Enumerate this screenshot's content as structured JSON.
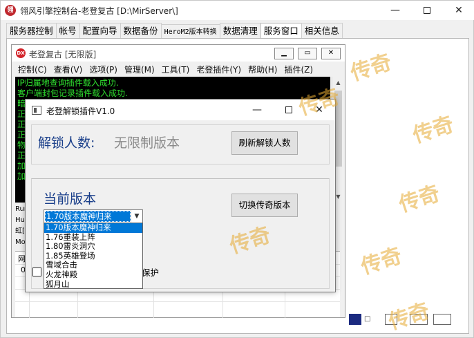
{
  "main_window": {
    "title": "翎风引擎控制台-老登复古 [D:\\MirServer\\]",
    "controls": {
      "minimize": "—",
      "close": "✕"
    },
    "tabs": [
      {
        "label": "服务器控制"
      },
      {
        "label": "帐号"
      },
      {
        "label": "配置向导"
      },
      {
        "label": "数据备份"
      },
      {
        "label": "HeroM2版本转换"
      },
      {
        "label": "数据清理"
      },
      {
        "label": "服务窗口"
      },
      {
        "label": "相关信息"
      }
    ],
    "active_tab": "服务窗口"
  },
  "inner_window": {
    "icon_text": "DX",
    "title": "老登复古 [无限版]",
    "menu": [
      {
        "label": "控制(C)"
      },
      {
        "label": "查看(V)"
      },
      {
        "label": "选项(P)"
      },
      {
        "label": "管理(M)"
      },
      {
        "label": "工具(T)"
      },
      {
        "label": "老登插件(Y)"
      },
      {
        "label": "帮助(H)"
      },
      {
        "label": "插件(Z)"
      }
    ],
    "console_lines": [
      "IP归属地查询插件载入成功.",
      "客户端封包记录插件载入成功.",
      "暗",
      "正",
      "正",
      "正",
      "物",
      "正",
      "加",
      "加"
    ],
    "info_lines": [
      "Run",
      "Hum",
      "虹[",
      "Mor"
    ],
    "grid_cells": [
      "网",
      "0"
    ]
  },
  "dialog": {
    "title": "老登解锁插件V1.0",
    "controls": {
      "minimize": "—",
      "close": "✕"
    },
    "unlock_label": "解锁人数:",
    "unlock_value": "无限制版本",
    "refresh_button": "刷新解锁人数",
    "version_label": "当前版本",
    "switch_button": "切换传奇版本",
    "version_select": {
      "selected": "1.70版本魔神归来",
      "options": [
        "1.70版本魔神归来",
        "1.76重装上阵",
        "1.80雷炎洞穴",
        "1.85英雄登场",
        "雪域合击",
        "火龙神殿",
        "狐月山"
      ]
    },
    "checkbox_label": "保护",
    "checkbox_checked": false
  },
  "watermark": "传奇",
  "colors": {
    "console_bg": "#000000",
    "console_text": "#2fe12f",
    "label_blue": "#1a3f8a",
    "selection": "#0078d7"
  }
}
